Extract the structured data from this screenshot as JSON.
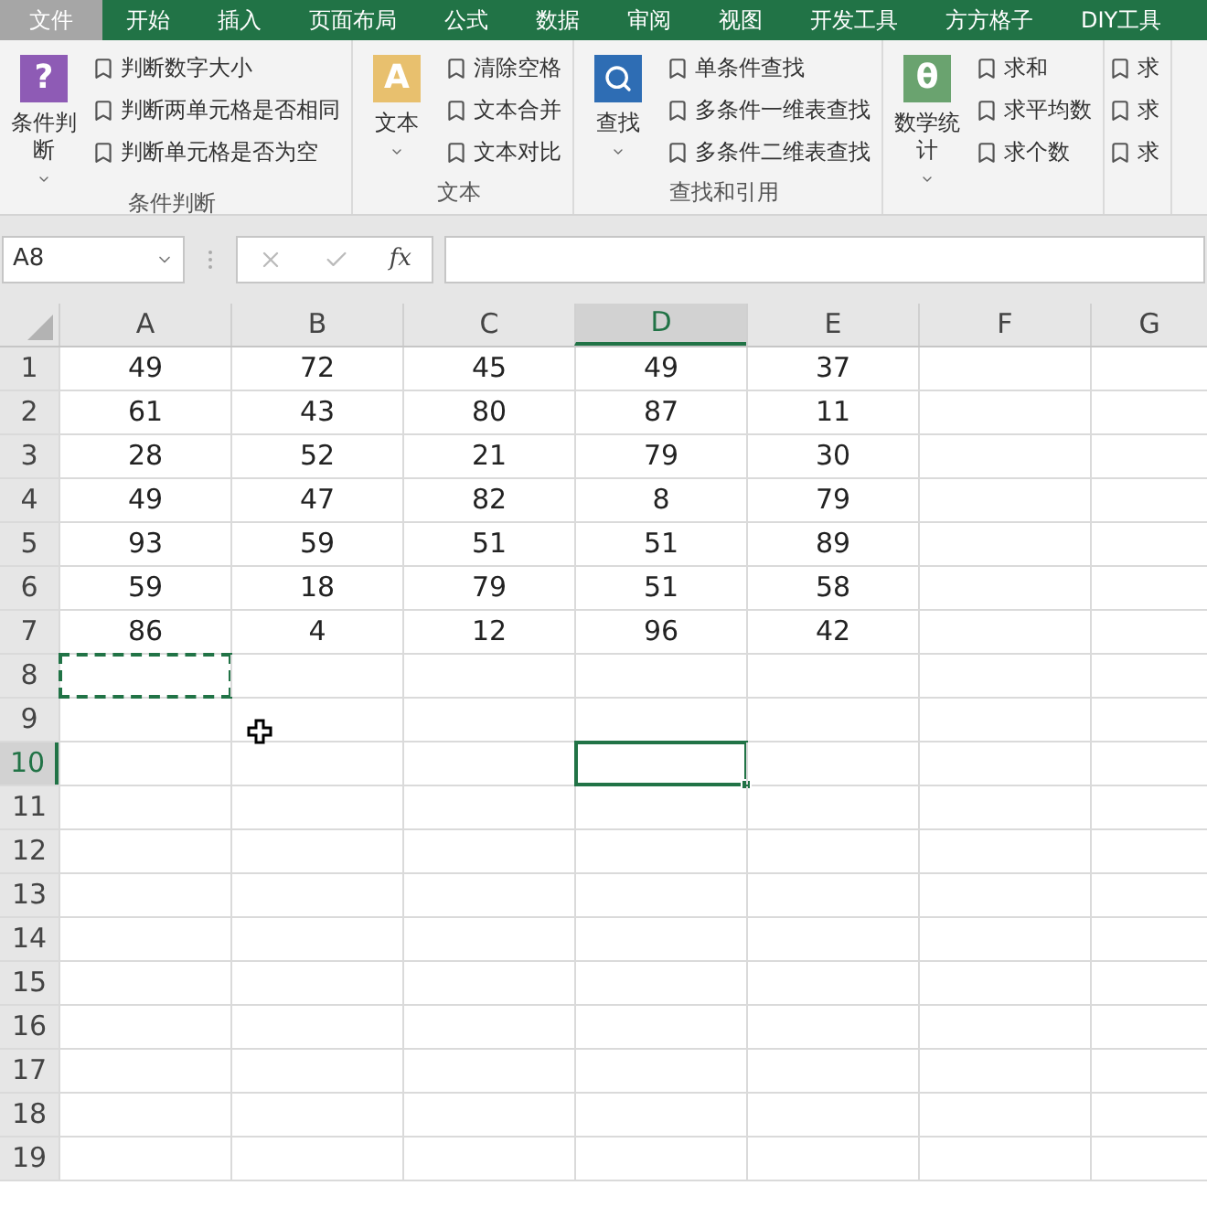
{
  "tabs": [
    {
      "label": "文件",
      "kind": "file"
    },
    {
      "label": "开始",
      "kind": "tab"
    },
    {
      "label": "插入",
      "kind": "tab"
    },
    {
      "label": "页面布局",
      "kind": "tab"
    },
    {
      "label": "公式",
      "kind": "tab"
    },
    {
      "label": "数据",
      "kind": "tab"
    },
    {
      "label": "审阅",
      "kind": "tab"
    },
    {
      "label": "视图",
      "kind": "tab"
    },
    {
      "label": "开发工具",
      "kind": "tab"
    },
    {
      "label": "方方格子",
      "kind": "tab"
    },
    {
      "label": "DIY工具",
      "kind": "tab"
    }
  ],
  "ribbon_groups": [
    {
      "label": "条件判断",
      "big_button": {
        "label": "条件判断",
        "kind": "glyph",
        "glyph": "?"
      },
      "items": [
        "判断数字大小",
        "判断两单元格是否相同",
        "判断单元格是否为空"
      ]
    },
    {
      "label": "文本",
      "big_button": {
        "label": "文本",
        "kind": "glyph",
        "glyph": "A"
      },
      "items": [
        "清除空格",
        "文本合并",
        "文本对比"
      ]
    },
    {
      "label": "查找和引用",
      "big_button": {
        "label": "查找",
        "kind": "search"
      },
      "items": [
        "单条件查找",
        "多条件一维表查找",
        "多条件二维表查找"
      ]
    },
    {
      "big_button": {
        "label": "数学统计",
        "kind": "glyph",
        "glyph": "θ"
      },
      "items": [
        "求和",
        "求平均数",
        "求个数"
      ]
    },
    {
      "items": [
        "求",
        "求",
        "求"
      ]
    }
  ],
  "formula_bar": {
    "name_box": "A8",
    "fx": "fx"
  },
  "columns": [
    {
      "label": "A",
      "selected": false
    },
    {
      "label": "B",
      "selected": false
    },
    {
      "label": "C",
      "selected": false
    },
    {
      "label": "D",
      "selected": true
    },
    {
      "label": "E",
      "selected": false
    },
    {
      "label": "F",
      "selected": false
    },
    {
      "label": "G",
      "selected": false
    }
  ],
  "rows": [
    {
      "label": "1",
      "selected": false,
      "cells": [
        "49",
        "72",
        "45",
        "49",
        "37"
      ]
    },
    {
      "label": "2",
      "selected": false,
      "cells": [
        "61",
        "43",
        "80",
        "87",
        "11"
      ]
    },
    {
      "label": "3",
      "selected": false,
      "cells": [
        "28",
        "52",
        "21",
        "79",
        "30"
      ]
    },
    {
      "label": "4",
      "selected": false,
      "cells": [
        "49",
        "47",
        "82",
        "8",
        "79"
      ]
    },
    {
      "label": "5",
      "selected": false,
      "cells": [
        "93",
        "59",
        "51",
        "51",
        "89"
      ]
    },
    {
      "label": "6",
      "selected": false,
      "cells": [
        "59",
        "18",
        "79",
        "51",
        "58"
      ]
    },
    {
      "label": "7",
      "selected": false,
      "cells": [
        "86",
        "4",
        "12",
        "96",
        "42"
      ]
    },
    {
      "label": "8",
      "selected": false,
      "marquee": true
    },
    {
      "label": "9",
      "selected": false
    },
    {
      "label": "10",
      "selected": true
    },
    {
      "label": "11",
      "selected": false
    },
    {
      "label": "12",
      "selected": false
    },
    {
      "label": "13",
      "selected": false
    },
    {
      "label": "14",
      "selected": false
    },
    {
      "label": "15",
      "selected": false
    },
    {
      "label": "16",
      "selected": false
    },
    {
      "label": "17",
      "selected": false
    },
    {
      "label": "18",
      "selected": false
    },
    {
      "label": "19",
      "selected": false
    }
  ]
}
